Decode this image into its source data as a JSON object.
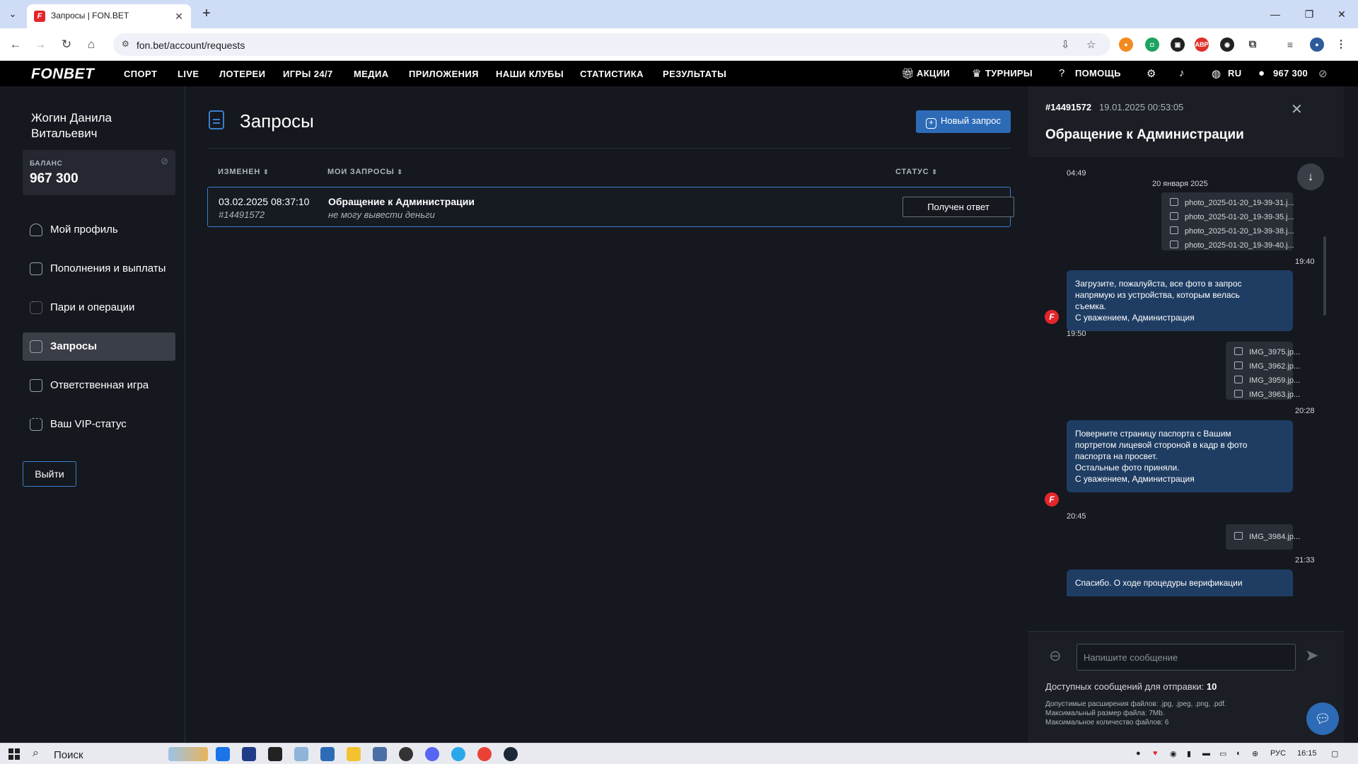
{
  "browser": {
    "tab_title": "Запросы | FON.BET",
    "favicon_letter": "F",
    "url": "fon.bet/account/requests"
  },
  "site": {
    "logo": "FONBET",
    "nav": [
      "СПОРТ",
      "LIVE",
      "ЛОТЕРЕИ",
      "ИГРЫ 24/7",
      "МЕДИА",
      "ПРИЛОЖЕНИЯ",
      "НАШИ КЛУБЫ",
      "СТАТИСТИКА",
      "РЕЗУЛЬТАТЫ"
    ],
    "promos": "АКЦИИ",
    "tournaments": "ТУРНИРЫ",
    "help": "ПОМОЩЬ",
    "lang": "RU",
    "header_balance": "967 300",
    "brand_color": "#e3262b",
    "accent_color": "#2d6bb7"
  },
  "sidebar": {
    "user_name": "Жогин Данила Витальевич",
    "balance_label": "БАЛАНС",
    "balance_value": "967 300",
    "items": [
      {
        "label": "Мой профиль",
        "icon": "user-icon"
      },
      {
        "label": "Пополнения и выплаты",
        "icon": "wallet-icon"
      },
      {
        "label": "Пари и операции",
        "icon": "grid-icon"
      },
      {
        "label": "Запросы",
        "icon": "document-icon",
        "active": true
      },
      {
        "label": "Ответственная игра",
        "icon": "lock-icon"
      },
      {
        "label": "Ваш VIP-статус",
        "icon": "crown-icon"
      }
    ],
    "logout": "Выйти"
  },
  "main": {
    "title": "Запросы",
    "new_request": "Новый запрос",
    "columns": {
      "changed": "ИЗМЕНЕН",
      "my_requests": "МОИ ЗАПРОСЫ",
      "status": "СТАТУС"
    },
    "requests": [
      {
        "date": "03.02.2025 08:37:10",
        "id": "#14491572",
        "title": "Обращение к Администрации",
        "description": "не могу вывести деньги",
        "status": "Получен ответ"
      }
    ]
  },
  "panel": {
    "id": "#14491572",
    "date": "19.01.2025 00:53:05",
    "title": "Обращение к Администрации",
    "chat": {
      "time_top": "04:49",
      "day_separator": "20 января 2025",
      "files_1": [
        "photo_2025-01-20_19-39-31.j...",
        "photo_2025-01-20_19-39-35.j...",
        "photo_2025-01-20_19-39-38.j...",
        "photo_2025-01-20_19-39-40.j..."
      ],
      "files_1_time": "19:40",
      "msg_1": [
        "Загрузите, пожалуйста, все фото в запрос",
        "напрямую из устройства, которым велась",
        "съемка.",
        "С уважением, Администрация"
      ],
      "msg_1_time": "19:50",
      "files_2": [
        "IMG_3975.jp...",
        "IMG_3962.jp...",
        "IMG_3959.jp...",
        "IMG_3963.jp..."
      ],
      "files_2_time": "20:28",
      "msg_2": [
        "Поверните страницу паспорта с Вашим",
        "портретом лицевой стороной в кадр в фото",
        "паспорта на просвет.",
        "Остальные фото приняли.",
        "С уважением, Администрация"
      ],
      "msg_2_time": "20:45",
      "files_3": [
        "IMG_3984.jp..."
      ],
      "files_3_time": "21:33",
      "msg_3": "Спасибо. О ходе процедуры верификации"
    },
    "input_placeholder": "Напишите сообщение",
    "available_label": "Доступных сообщений для отправки:",
    "available_count": "10",
    "rules": [
      "Допустимые расширения файлов: .jpg, .jpeg, .png, .pdf.",
      "Максимальный размер файла: 7Mb.",
      "Максимальное количество файлов: 6"
    ]
  },
  "taskbar": {
    "search": "Поиск",
    "lang": "РУС",
    "time": "16:15"
  }
}
